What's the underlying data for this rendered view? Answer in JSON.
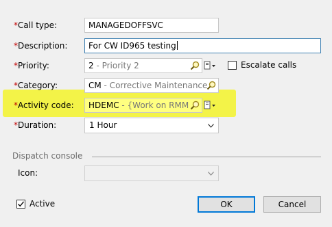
{
  "fields": {
    "call_type": {
      "required_mark": "*",
      "label": "Call type:",
      "value": "MANAGEDOFFSVC"
    },
    "description": {
      "required_mark": "*",
      "label": "Description:",
      "value": "For CW ID965 testing"
    },
    "priority": {
      "required_mark": "*",
      "label": "Priority:",
      "code": "2",
      "hint": " - Priority 2"
    },
    "category": {
      "required_mark": "*",
      "label": "Category:",
      "code": "CM",
      "hint": " - Corrective Maintenance"
    },
    "activity_code": {
      "required_mark": "*",
      "label": "Activity code:",
      "code": "HDEMC",
      "hint": " - {Work on RMM"
    },
    "duration": {
      "required_mark": "*",
      "label": "Duration:",
      "value": "1 Hour"
    }
  },
  "escalate": {
    "label": "Escalate calls",
    "checked": false
  },
  "dispatch": {
    "section_title": "Dispatch console",
    "icon_label": "Icon:",
    "icon_value": ""
  },
  "active": {
    "label": "Active",
    "checked": true
  },
  "buttons": {
    "ok": "OK",
    "cancel": "Cancel"
  },
  "colors": {
    "required": "#c00000",
    "highlight": "#f3f32a",
    "focus_border": "#3c7fb1",
    "default_button_border": "#0078d7"
  },
  "icons": [
    "search-icon",
    "lookup-menu-icon",
    "chevron-down-icon",
    "checkmark-icon"
  ]
}
